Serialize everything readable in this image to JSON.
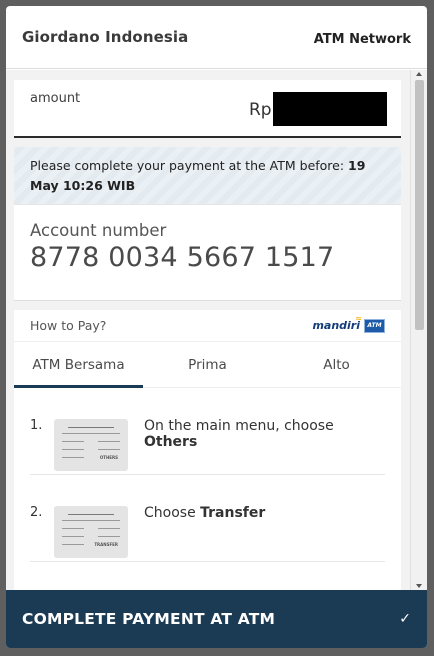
{
  "header": {
    "merchant": "Giordano Indonesia",
    "payment_method": "ATM Network"
  },
  "amount": {
    "label": "amount",
    "currency": "Rp",
    "value_redacted": true
  },
  "deadline": {
    "text": "Please complete your payment at the ATM before: ",
    "date": "19 May 10:26 WIB"
  },
  "account": {
    "label": "Account number",
    "number": "8778 0034 5667 1517"
  },
  "howto": {
    "title": "How to Pay?",
    "logos": {
      "mandiri": "mandiri",
      "atm_bersama": "ATM"
    },
    "tabs": [
      {
        "label": "ATM Bersama",
        "active": true
      },
      {
        "label": "Prima",
        "active": false
      },
      {
        "label": "Alto",
        "active": false
      }
    ],
    "steps": [
      {
        "number": "1.",
        "text": "On the main menu, choose ",
        "emphasis": "Others",
        "thumb_tag": "OTHERS"
      },
      {
        "number": "2.",
        "text": "Choose ",
        "emphasis": "Transfer",
        "thumb_tag": "TRANSFER"
      }
    ]
  },
  "cta": {
    "label": "COMPLETE PAYMENT AT ATM",
    "icon": "checkmark-icon"
  },
  "colors": {
    "primary": "#1b3a54",
    "backdrop": "#5f5f5f",
    "deadline_bg": "#eaf0f4"
  }
}
